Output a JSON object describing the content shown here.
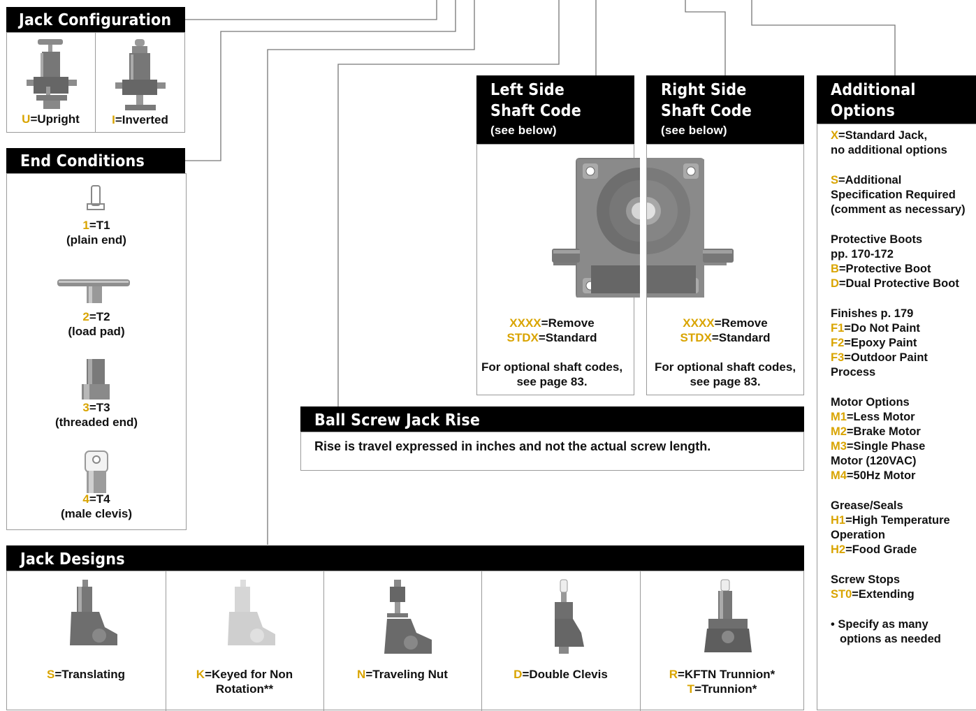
{
  "jack_configuration": {
    "title": "Jack Configuration",
    "upright": {
      "code": "U",
      "label": "=Upright"
    },
    "inverted": {
      "code": "I",
      "label": "=Inverted"
    }
  },
  "end_conditions": {
    "title": "End Conditions",
    "items": [
      {
        "code": "1",
        "label": "=T1",
        "desc": "(plain end)"
      },
      {
        "code": "2",
        "label": "=T2",
        "desc": "(load pad)"
      },
      {
        "code": "3",
        "label": "=T3",
        "desc": "(threaded end)"
      },
      {
        "code": "4",
        "label": "=T4",
        "desc": "(male clevis)"
      }
    ]
  },
  "left_shaft": {
    "title_line1": "Left Side",
    "title_line2": "Shaft Code",
    "subtitle": "(see below)",
    "remove_code": "XXXX",
    "remove_label": "=Remove",
    "standard_code": "STDX",
    "standard_label": "=Standard",
    "note_line1": "For optional shaft codes,",
    "note_line2": "see page 83."
  },
  "right_shaft": {
    "title_line1": "Right Side",
    "title_line2": "Shaft Code",
    "subtitle": "(see below)",
    "remove_code": "XXXX",
    "remove_label": "=Remove",
    "standard_code": "STDX",
    "standard_label": "=Standard",
    "note_line1": "For optional shaft codes,",
    "note_line2": "see page 83."
  },
  "additional_options": {
    "title_line1": "Additional",
    "title_line2": "Options",
    "x_code": "X",
    "x_line1": "=Standard Jack,",
    "x_line2": "no additional options",
    "s_code": "S",
    "s_line1": "=Additional",
    "s_line2": "Specification Required",
    "s_line3": "(comment as necessary)",
    "boots_h1": "Protective Boots",
    "boots_h2": "pp. 170-172",
    "b_code": "B",
    "b_label": "=Protective Boot",
    "d_code": "D",
    "d_label": "=Dual Protective Boot",
    "finishes_h": "Finishes p. 179",
    "f1_code": "F1",
    "f1_label": "=Do Not Paint",
    "f2_code": "F2",
    "f2_label": "=Epoxy Paint",
    "f3_code": "F3",
    "f3_label": "=Outdoor Paint",
    "f3_line2": "Process",
    "motor_h": "Motor Options",
    "m1_code": "M1",
    "m1_label": "=Less Motor",
    "m2_code": "M2",
    "m2_label": "=Brake Motor",
    "m3_code": "M3",
    "m3_label": "=Single Phase",
    "m3_line2": "Motor (120VAC)",
    "m4_code": "M4",
    "m4_label": "=50Hz Motor",
    "grease_h": "Grease/Seals",
    "h1_code": "H1",
    "h1_label": "=High Temperature",
    "h1_line2": "Operation",
    "h2_code": "H2",
    "h2_label": "=Food Grade",
    "stops_h": "Screw Stops",
    "st0_code": "ST0",
    "st0_label": "=Extending",
    "bullet_line1": "• Specify as many",
    "bullet_line2": "options as needed"
  },
  "ball_screw_rise": {
    "title": "Ball Screw Jack Rise",
    "text": "Rise is travel expressed in inches and not the actual screw length."
  },
  "jack_designs": {
    "title": "Jack Designs",
    "items": [
      {
        "code": "S",
        "label": "=Translating"
      },
      {
        "code": "K",
        "label": "=Keyed for Non",
        "label2": "Rotation**"
      },
      {
        "code": "N",
        "label": "=Traveling Nut"
      },
      {
        "code": "D",
        "label": "=Double Clevis"
      },
      {
        "code": "R",
        "label": "=KFTN Trunnion*",
        "code2": "T",
        "label2": "=Trunnion*"
      }
    ]
  },
  "colors": {
    "code": "#d9a400",
    "header_bg": "#000000",
    "border": "#9a9a9a",
    "line": "#777777"
  }
}
